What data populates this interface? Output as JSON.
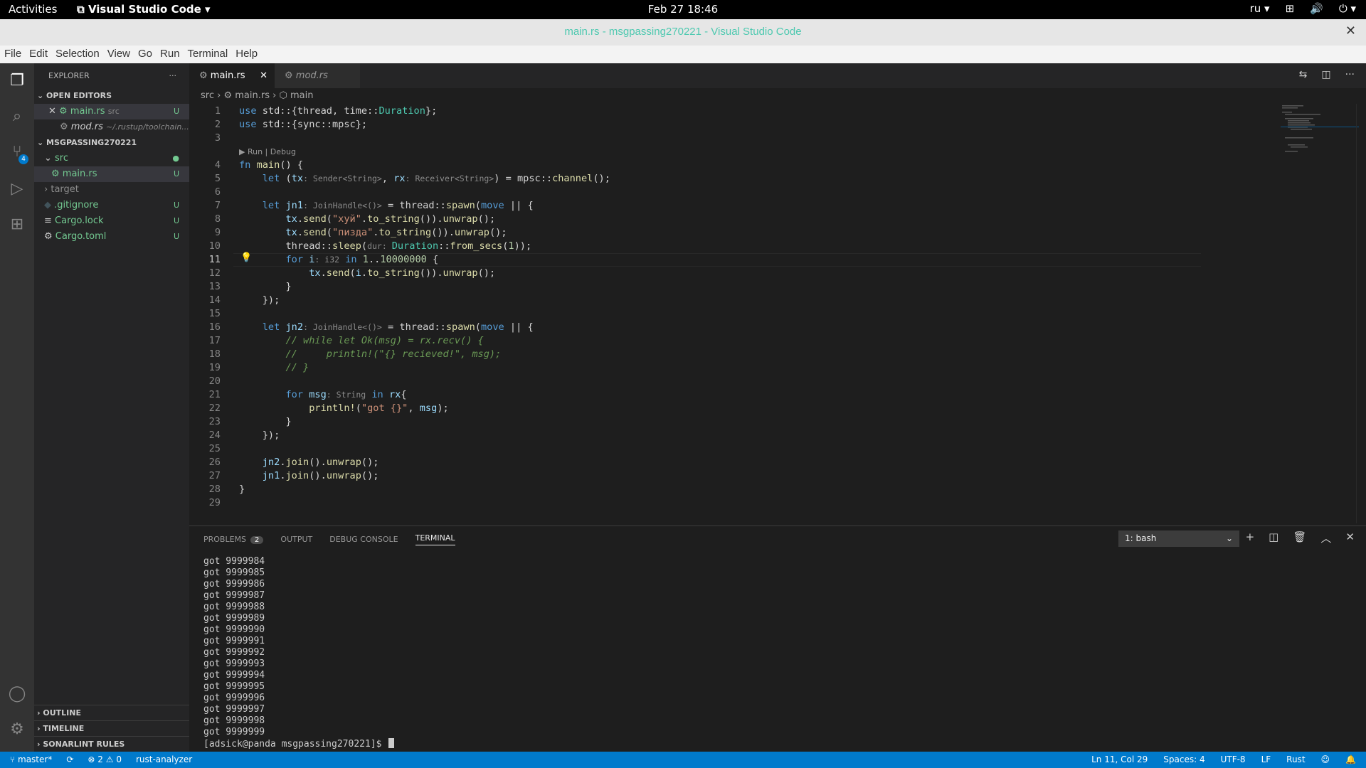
{
  "topbar": {
    "activities": "Activities",
    "app": "Visual Studio Code",
    "clock": "Feb 27  18:46",
    "lang": "ru"
  },
  "window": {
    "title": "main.rs - msgpassing270221 - Visual Studio Code"
  },
  "menu": [
    "File",
    "Edit",
    "Selection",
    "View",
    "Go",
    "Run",
    "Terminal",
    "Help"
  ],
  "activity": {
    "scm_badge": "4",
    "icons": [
      "files-icon",
      "search-icon",
      "source-control-icon",
      "run-debug-icon",
      "extensions-icon",
      "account-icon",
      "gear-icon"
    ]
  },
  "sidebar": {
    "header": "EXPLORER",
    "open_editors": "OPEN EDITORS",
    "open_items": [
      {
        "name": "main.rs",
        "desc": "src",
        "status": "U"
      },
      {
        "name": "mod.rs",
        "desc": "~/.rustup/toolchain..."
      }
    ],
    "project": "MSGPASSING270221",
    "tree": [
      {
        "name": "src",
        "kind": "folder-open"
      },
      {
        "name": "main.rs",
        "status": "U"
      },
      {
        "name": "target",
        "kind": "folder"
      },
      {
        "name": ".gitignore",
        "status": "U"
      },
      {
        "name": "Cargo.lock",
        "status": "U"
      },
      {
        "name": "Cargo.toml",
        "status": "U"
      }
    ],
    "bottom": [
      "OUTLINE",
      "TIMELINE",
      "SONARLINT RULES"
    ]
  },
  "tabs": [
    {
      "label": "main.rs"
    },
    {
      "label": "mod.rs"
    }
  ],
  "breadcrumb": {
    "a": "src",
    "b": "main.rs",
    "c": "main"
  },
  "codelens": "▶ Run | Debug",
  "code": [
    "<span class=k>use</span> std::{thread, time::<span class=t>Duration</span>};",
    "<span class=k>use</span> std::{sync::mpsc};",
    "",
    "<span class=k>fn</span> <span class=f>main</span>() {",
    "    <span class=k>let</span> (<span class=v>tx</span><span class=h>: Sender&lt;String&gt;</span>, <span class=v>rx</span><span class=h>: Receiver&lt;String&gt;</span>) = mpsc::<span class=f>channel</span>();",
    "",
    "    <span class=k>let</span> <span class=v>jn1</span><span class=h>: JoinHandle&lt;()&gt;</span> = thread::<span class=f>spawn</span>(<span class=k>move</span> || {",
    "        <span class=v>tx</span>.<span class=f>send</span>(<span class=s>\"хуй\"</span>.<span class=f>to_string</span>()).<span class=f>unwrap</span>();",
    "        <span class=v>tx</span>.<span class=f>send</span>(<span class=s>\"пизда\"</span>.<span class=f>to_string</span>()).<span class=f>unwrap</span>();",
    "        thread::<span class=f>sleep</span>(<span class=h>dur: </span><span class=t>Duration</span>::<span class=f>from_secs</span>(<span class=n>1</span>));",
    "        <span class=k>for</span> <span class=v>i</span><span class=h>: i32</span> <span class=k>in</span> <span class=n>1</span>..<span class=n>10000000</span> {",
    "            <span class=v>tx</span>.<span class=f>send</span>(<span class=v>i</span>.<span class=f>to_string</span>()).<span class=f>unwrap</span>();",
    "        }",
    "    });",
    "",
    "    <span class=k>let</span> <span class=v>jn2</span><span class=h>: JoinHandle&lt;()&gt;</span> = thread::<span class=f>spawn</span>(<span class=k>move</span> || {",
    "        <span class=c>// while let Ok(msg) = rx.recv() {</span>",
    "        <span class=c>//     println!(\"{} recieved!\", msg);</span>",
    "        <span class=c>// }</span>",
    "",
    "        <span class=k>for</span> <span class=v>msg</span><span class=h>: String</span> <span class=k>in</span> <span class=v>rx</span>{",
    "            <span class=f>println!</span>(<span class=s>\"got {}\"</span>, <span class=v>msg</span>);",
    "        }",
    "    });",
    "",
    "    <span class=v>jn2</span>.<span class=f>join</span>().<span class=f>unwrap</span>();",
    "    <span class=v>jn1</span>.<span class=f>join</span>().<span class=f>unwrap</span>();",
    "}",
    ""
  ],
  "current_line": 11,
  "panel": {
    "tabs": [
      "PROBLEMS",
      "OUTPUT",
      "DEBUG CONSOLE",
      "TERMINAL"
    ],
    "problems_count": "2",
    "terminal_select": "1: bash",
    "lines": [
      "got 9999984",
      "got 9999985",
      "got 9999986",
      "got 9999987",
      "got 9999988",
      "got 9999989",
      "got 9999990",
      "got 9999991",
      "got 9999992",
      "got 9999993",
      "got 9999994",
      "got 9999995",
      "got 9999996",
      "got 9999997",
      "got 9999998",
      "got 9999999"
    ],
    "prompt": "[adsick@panda msgpassing270221]$ "
  },
  "status": {
    "branch": "master*",
    "errors": "2",
    "warnings": "0",
    "analyzer": "rust-analyzer",
    "position": "Ln 11, Col 29",
    "spaces": "Spaces: 4",
    "encoding": "UTF-8",
    "eol": "LF",
    "language": "Rust"
  },
  "colors": {
    "accent": "#007acc",
    "untracked": "#73c991"
  }
}
